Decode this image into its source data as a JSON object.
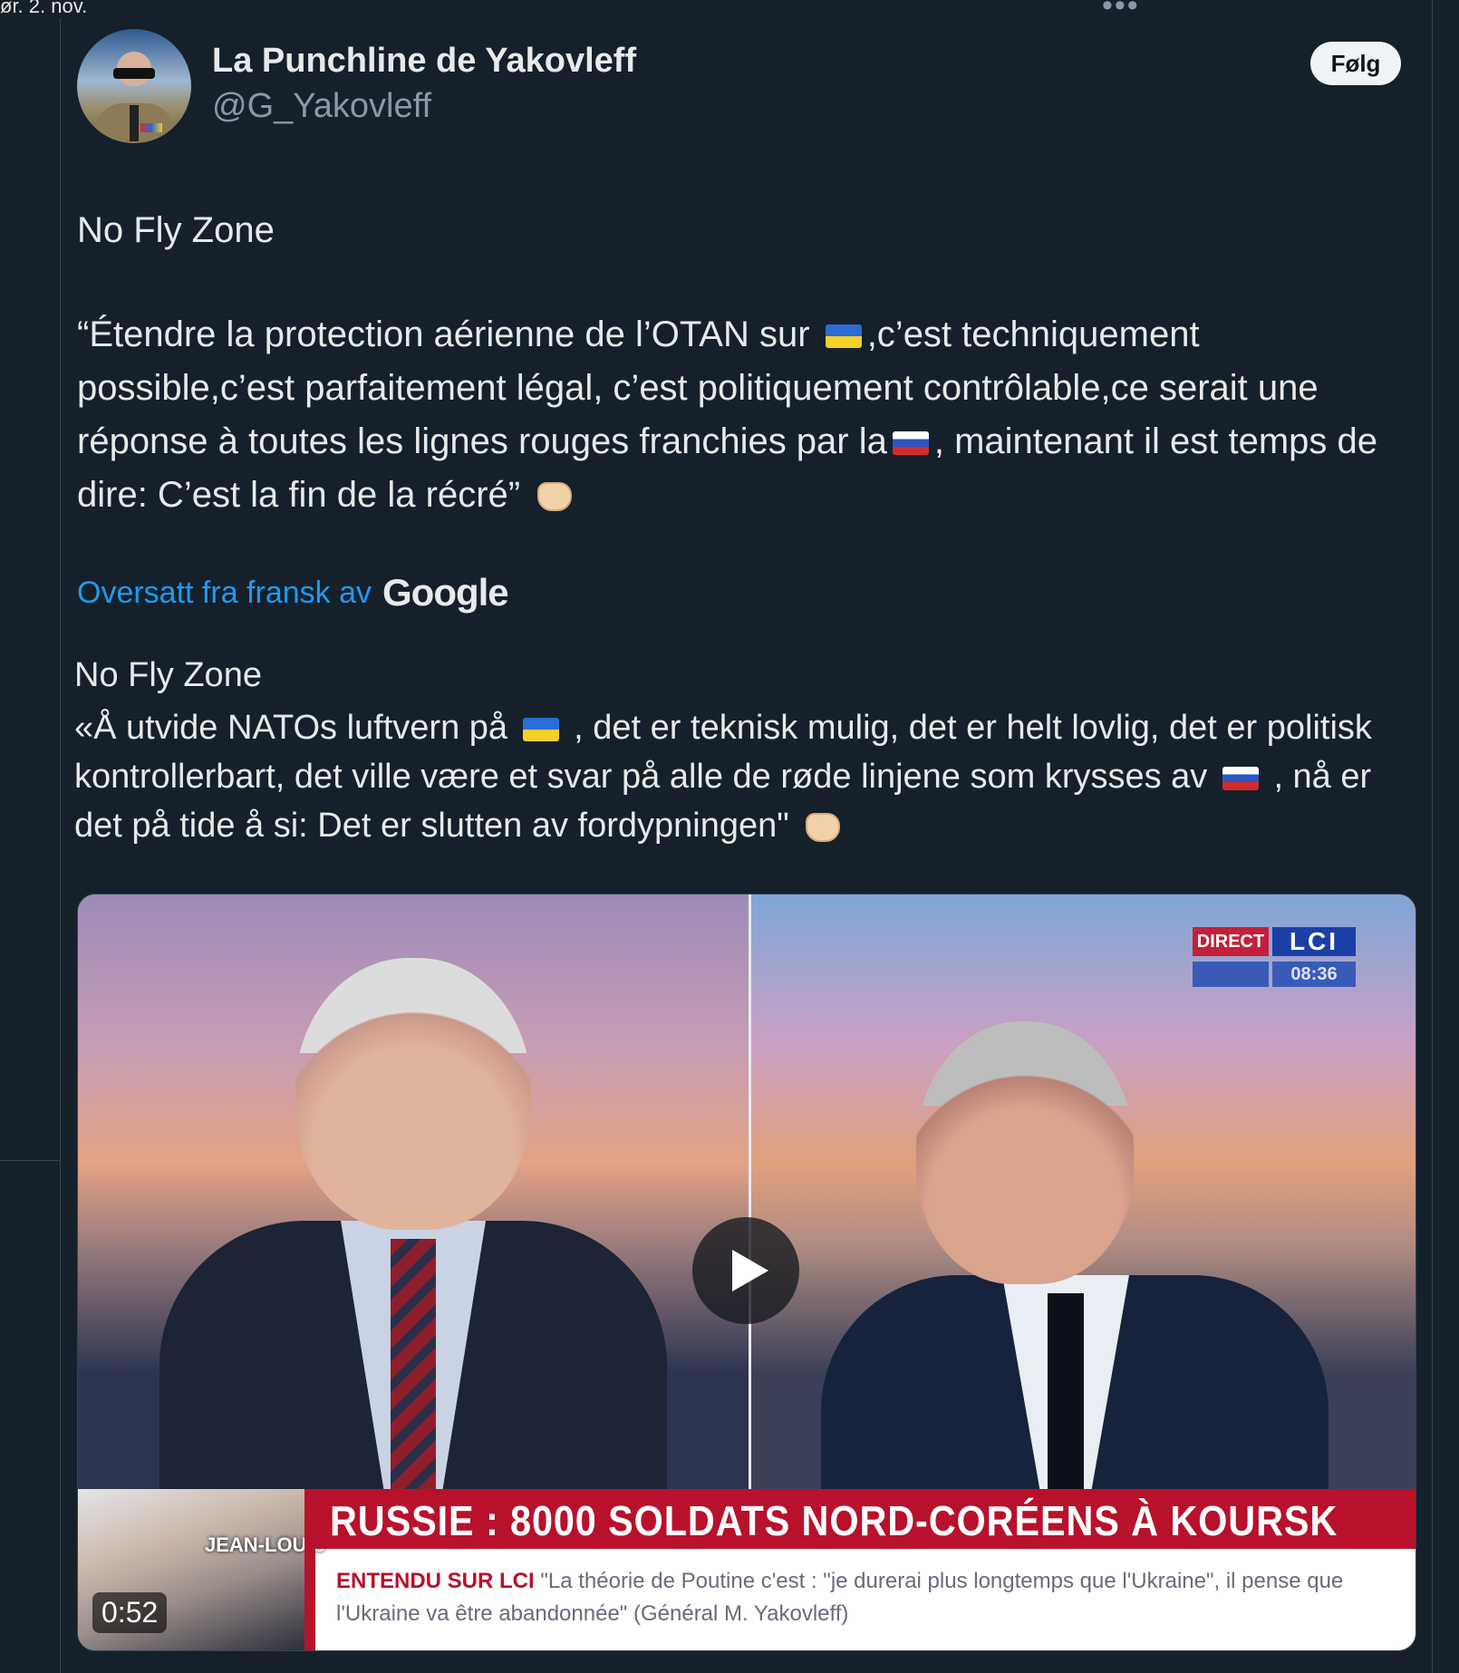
{
  "page": {
    "date_fragment": "ør. 2. nov."
  },
  "post": {
    "author_name": "La Punchline de Yakovleff",
    "author_handle": "@G_Yakovleff",
    "follow_label": "Følg",
    "text_title": "No Fly Zone",
    "text_part1": "“Étendre la protection aérienne de l’OTAN sur",
    "text_part2": ",c’est techniquement possible,c’est parfaitement légal, c’est politiquement contrôlable,ce serait une réponse à toutes les lignes rouges franchies par la",
    "text_part3": ", maintenant il est temps de dire: C’est la fin de la récré”",
    "translated_label": "Oversatt fra fransk av",
    "translated_brand": "Google",
    "translation_title": "No Fly Zone",
    "translation_part1": "«Å utvide NATOs luftvern på",
    "translation_part2": ", det er teknisk mulig, det er helt lovlig, det er politisk kontrollerbart, det ville være et svar på alle de røde linjene som krysses av",
    "translation_part3": ", nå er det på tide å si: Det er slutten av fordypningen\""
  },
  "video": {
    "badge_direct": "DIRECT",
    "badge_logo": "LCI",
    "badge_time": "08:36",
    "guest_tag": "JEAN-LOUIS",
    "headline": "RUSSIE : 8000 SOLDATS NORD-CORÉENS À KOURSK",
    "sub_prefix": "ENTENDU SUR LCI",
    "sub_text": "\"La théorie de Poutine c'est : \"je durerai plus longtemps que l'Ukraine\", il pense que l'Ukraine va être abandonnée\" (Général M. Yakovleff)",
    "timer": "0:52"
  },
  "icons": {
    "more": "more-horizontal-icon",
    "play": "play-icon",
    "flag_ua": "ukraine-flag-icon",
    "flag_ru": "russia-flag-icon",
    "fist": "oncoming-fist-icon"
  }
}
